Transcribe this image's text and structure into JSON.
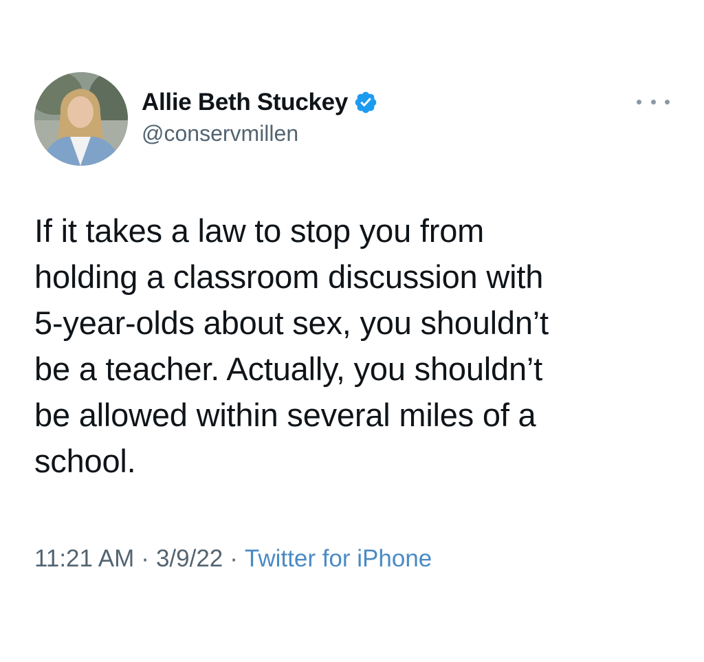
{
  "author": {
    "display_name": "Allie Beth Stuckey",
    "handle": "@conservmillen",
    "verified": true
  },
  "icons": {
    "verified": "verified-badge-icon",
    "more": "more-options-icon",
    "avatar": "profile-photo"
  },
  "tweet": {
    "lines": [
      "If it takes a law to stop you from",
      "holding a classroom discussion with",
      "5-year-olds about sex, you shouldn’t",
      "be a teacher. Actually, you shouldn’t",
      "be allowed within several miles of a",
      "school."
    ]
  },
  "meta": {
    "time": "11:21 AM",
    "date": "3/9/22",
    "separator": "·",
    "source": "Twitter for iPhone"
  },
  "colors": {
    "verified_blue": "#1d9bf0",
    "secondary_text": "#536471",
    "source_link": "#4a8ac4"
  }
}
